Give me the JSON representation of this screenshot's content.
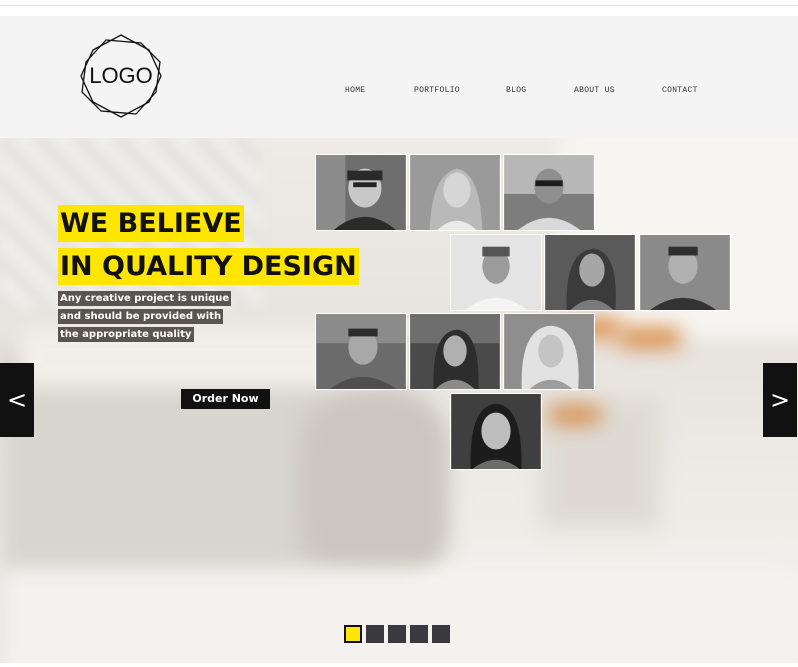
{
  "header": {
    "logo_text": "LOGO",
    "nav": [
      "HOME",
      "PORTFOLIO",
      "BLOG",
      "ABOUT US",
      "CONTACT"
    ]
  },
  "hero": {
    "headline_line1": "WE BELIEVE",
    "headline_line2": "IN QUALITY DESIGN",
    "subtext_lines": [
      "Any creative project is unique",
      "and should be provided with",
      "the appropriate quality"
    ],
    "cta_label": "Order Now",
    "prev_label": "<",
    "next_label": ">"
  },
  "team_photos": [
    "portrait-1",
    "portrait-2",
    "portrait-3",
    "portrait-4",
    "portrait-5",
    "portrait-6",
    "portrait-7",
    "portrait-8",
    "portrait-9",
    "portrait-10"
  ],
  "slider": {
    "count": 5,
    "active_index": 0
  },
  "colors": {
    "accent": "#ffe600",
    "dark": "#111111",
    "dot_inactive": "#3a3a3e",
    "header_bg": "#f4f4f4"
  }
}
